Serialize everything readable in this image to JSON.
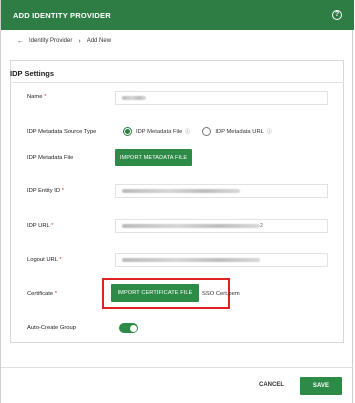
{
  "header": {
    "title": "ADD IDENTITY PROVIDER"
  },
  "breadcrumb": {
    "parent": "Identity Provider",
    "current": "Add New"
  },
  "card": {
    "title": "IDP Settings"
  },
  "form": {
    "name_label": "Name",
    "metadata_source_label": "IDP Metadata Source Type",
    "radio_file_label": "IDP Metadata File",
    "radio_url_label": "IDP Metadata URL",
    "metadata_file_label": "IDP Metadata File",
    "import_metadata_label": "IMPORT METADATA FILE",
    "entity_id_label": "IDP Entity ID",
    "idp_url_label": "IDP URL",
    "idp_url_value_tail": "2",
    "logout_url_label": "Logout URL",
    "certificate_label": "Certificate",
    "import_certificate_label": "IMPORT CERTIFICATE FILE",
    "certificate_file_name": "SSO Cert.pem",
    "auto_create_label": "Auto-Create Group"
  },
  "footer": {
    "cancel_label": "CANCEL",
    "save_label": "SAVE"
  },
  "colors": {
    "brand_green": "#2e7d45",
    "highlight_red": "#e02222"
  }
}
